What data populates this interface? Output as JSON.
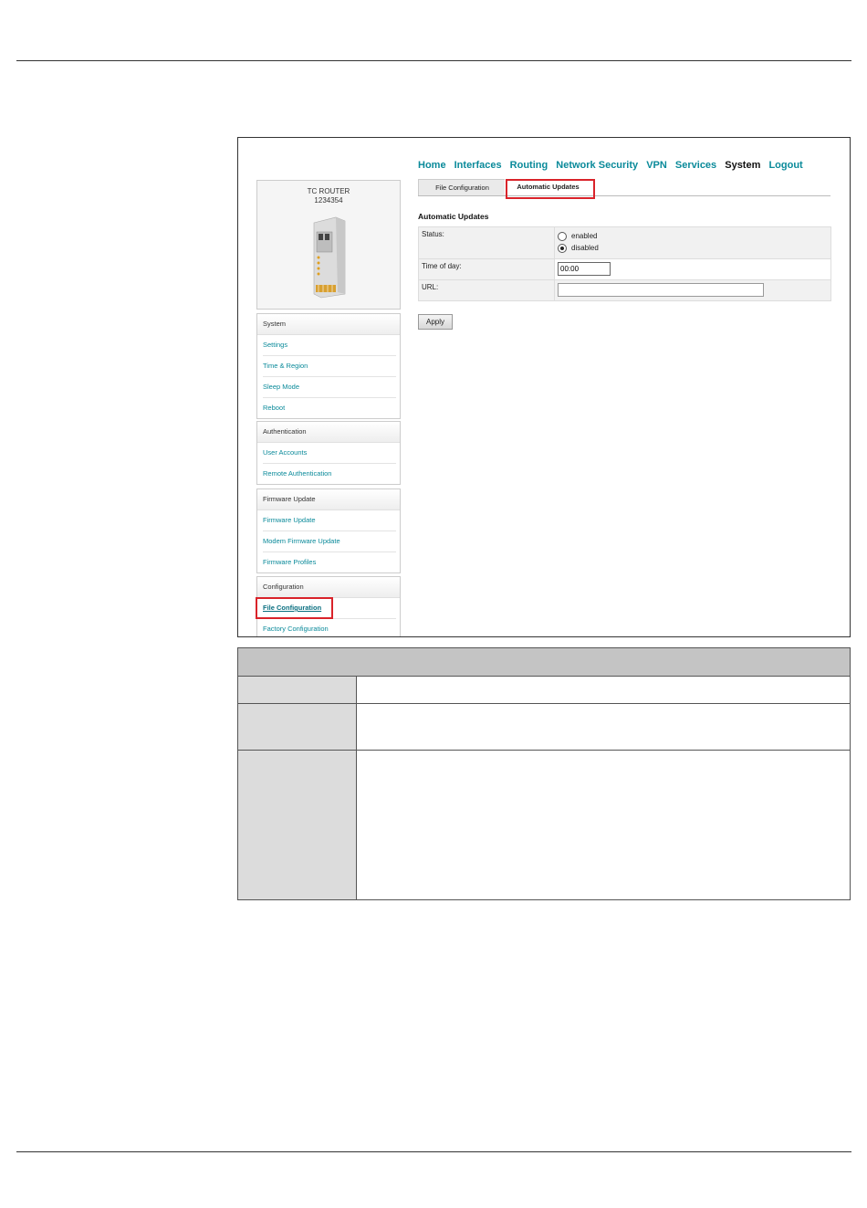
{
  "device": {
    "name": "TC ROUTER",
    "serial": "1234354"
  },
  "nav": [
    "Home",
    "Interfaces",
    "Routing",
    "Network Security",
    "VPN",
    "Services",
    "System",
    "Logout"
  ],
  "nav_current": "System",
  "tabs": [
    "File Configuration",
    "Automatic Updates"
  ],
  "active_tab": "Automatic Updates",
  "section_title": "Automatic Updates",
  "form": {
    "status_label": "Status:",
    "status_options": [
      "enabled",
      "disabled"
    ],
    "status_selected": "disabled",
    "time_label": "Time of day:",
    "time_value": "00:00",
    "url_label": "URL:",
    "url_value": ""
  },
  "apply_label": "Apply",
  "sidebar": {
    "system": {
      "title": "System",
      "items": [
        "Settings",
        "Time & Region",
        "Sleep Mode",
        "Reboot"
      ]
    },
    "authentication": {
      "title": "Authentication",
      "items": [
        "User Accounts",
        "Remote Authentication"
      ]
    },
    "firmware": {
      "title": "Firmware Update",
      "items": [
        "Firmware Update",
        "Modem Firmware Update",
        "Firmware Profiles"
      ]
    },
    "configuration": {
      "title": "Configuration",
      "items": [
        "File Configuration",
        "Factory Configuration"
      ]
    }
  },
  "highlight_color": "#d9232a",
  "link_color": "#0a8a9a"
}
